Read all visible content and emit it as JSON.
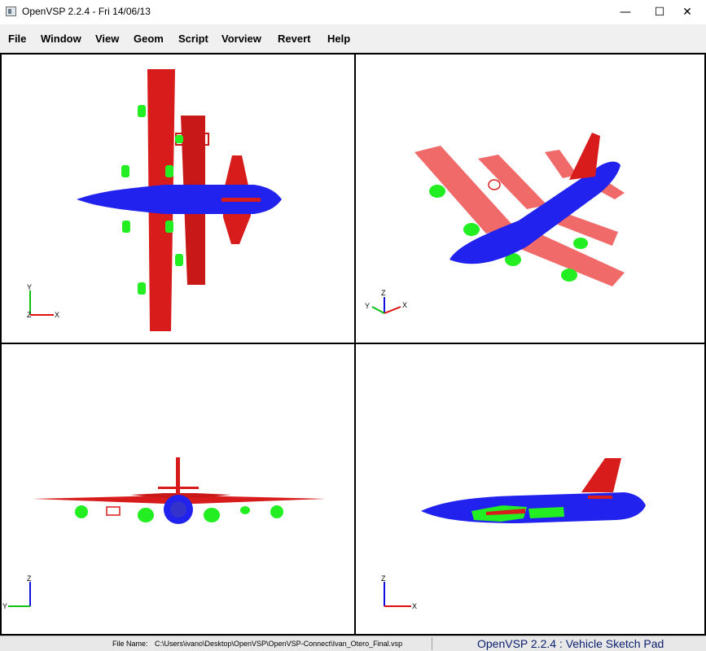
{
  "window": {
    "title": "OpenVSP 2.2.4 - Fri 14/06/13",
    "controls": {
      "minimize": "—",
      "maximize": "☐",
      "close": "✕"
    }
  },
  "menu": {
    "items": [
      "File",
      "Window",
      "View",
      "Geom",
      "Script",
      "Vorview",
      "Revert",
      "Help"
    ]
  },
  "viewports": {
    "top": {
      "axes": {
        "up": "Y",
        "right": "X",
        "center": "Z"
      }
    },
    "iso": {
      "axes": {
        "left": "Y",
        "up": "Z",
        "right": "X"
      }
    },
    "front": {
      "axes": {
        "up": "Z",
        "left": "Y"
      }
    },
    "side": {
      "axes": {
        "up": "Z",
        "right": "X"
      }
    }
  },
  "colors": {
    "fuselage": "#2222ee",
    "wing": "#d81b1b",
    "wing_light": "#f06a6a",
    "engine": "#22ee22",
    "axis_x": "#e01010",
    "axis_y": "#10c010",
    "axis_z": "#1010e0"
  },
  "status": {
    "file_label": "File Name:",
    "file_path": "C:\\Users\\ivano\\Desktop\\OpenVSP\\OpenVSP-Connect\\Ivan_Otero_Final.vsp",
    "app_info": "OpenVSP 2.2.4 : Vehicle Sketch Pad"
  }
}
